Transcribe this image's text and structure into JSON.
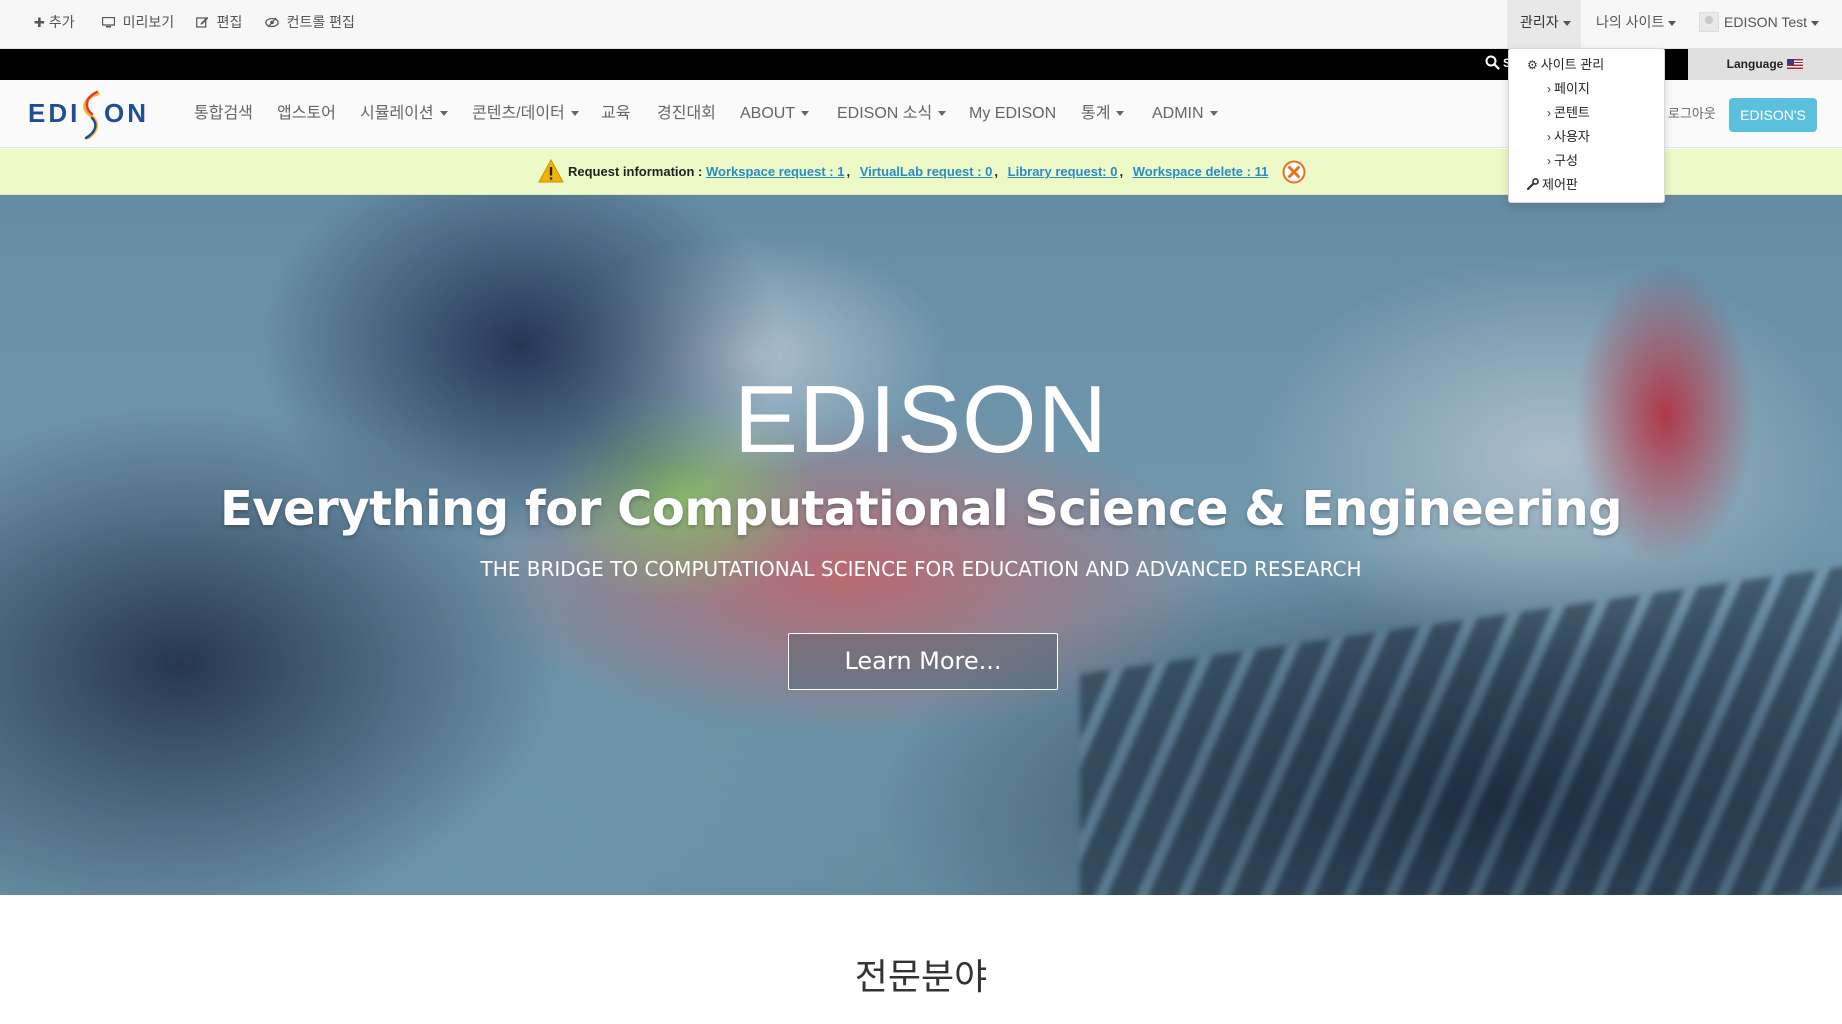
{
  "admin_bar": {
    "add_label": "추가",
    "preview_label": "미리보기",
    "edit_label": "편집",
    "control_edit_label": "컨트롤 편집",
    "admin_label": "관리자",
    "my_sites_label": "나의 사이트",
    "user_label": "EDISON Test"
  },
  "admin_menu": {
    "site_admin": "사이트 관리",
    "pages": "페이지",
    "content": "콘텐트",
    "users": "사용자",
    "configuration": "구성",
    "control_panel": "제어판"
  },
  "utility": {
    "search_fragment": "S",
    "language_label": "Language"
  },
  "logo": {
    "text_left": "EDI",
    "text_right": "ON"
  },
  "nav": {
    "items": [
      {
        "label": "통합검색",
        "dropdown": false
      },
      {
        "label": "앱스토어",
        "dropdown": false
      },
      {
        "label": "시뮬레이션",
        "dropdown": true
      },
      {
        "label": "콘텐츠/데이터",
        "dropdown": true
      },
      {
        "label": "교육",
        "dropdown": false
      },
      {
        "label": "경진대회",
        "dropdown": false
      },
      {
        "label": "ABOUT",
        "dropdown": true
      },
      {
        "label": "EDISON 소식",
        "dropdown": true
      },
      {
        "label": "My EDISON",
        "dropdown": false
      },
      {
        "label": "통계",
        "dropdown": true
      },
      {
        "label": "ADMIN",
        "dropdown": true
      }
    ],
    "logout_label": "로그아웃",
    "edisons_label": "EDISON'S"
  },
  "alert": {
    "label": "Request information :",
    "workspace_request": "Workspace request : 1",
    "virtuallab_request": "VirtualLab request : 0",
    "library_request": "Library request: 0",
    "workspace_delete": "Workspace delete : 11",
    "separator": ","
  },
  "hero": {
    "title": "EDISON",
    "subtitle": "Everything for Computational Science & Engineering",
    "tagline": "THE BRIDGE TO COMPUTATIONAL SCIENCE FOR EDUCATION AND ADVANCED RESEARCH",
    "button_label": "Learn More..."
  },
  "section": {
    "title": "전문분야"
  },
  "colors": {
    "accent_button": "#5bc0de",
    "alert_background": "#edfac7",
    "link": "#2a8bc5",
    "warning": "#f0b400",
    "close_icon": "#e8711c"
  }
}
